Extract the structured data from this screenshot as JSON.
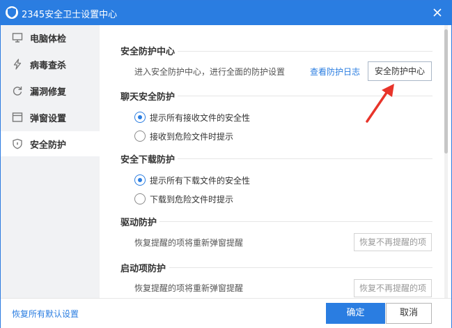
{
  "window": {
    "title": "2345安全卫士设置中心"
  },
  "sidebar": {
    "items": [
      {
        "label": "电脑体检",
        "icon": "monitor-icon"
      },
      {
        "label": "病毒查杀",
        "icon": "lightning-icon"
      },
      {
        "label": "漏洞修复",
        "icon": "refresh-icon"
      },
      {
        "label": "弹窗设置",
        "icon": "window-icon"
      },
      {
        "label": "安全防护",
        "icon": "shield-icon",
        "active": true
      }
    ]
  },
  "sections": {
    "protection_center": {
      "title": "安全防护中心",
      "desc": "进入安全防护中心，进行全面的防护设置",
      "log_link": "查看防护日志",
      "button": "安全防护中心"
    },
    "chat": {
      "title": "聊天安全防护",
      "options": [
        {
          "label": "提示所有接收文件的安全性",
          "checked": true
        },
        {
          "label": "接收到危险文件时提示",
          "checked": false
        }
      ]
    },
    "download": {
      "title": "安全下载防护",
      "options": [
        {
          "label": "提示所有下载文件的安全性",
          "checked": true
        },
        {
          "label": "下载到危险文件时提示",
          "checked": false
        }
      ]
    },
    "driver": {
      "title": "驱动防护",
      "desc": "恢复提醒的项将重新弹窗提醒",
      "button": "恢复不再提醒的项"
    },
    "startup": {
      "title": "启动项防护",
      "desc": "恢复提醒的项将重新弹窗提醒",
      "button": "恢复不再提醒的项"
    }
  },
  "footer": {
    "reset_link": "恢复所有默认设置",
    "ok": "确定",
    "cancel": "取消"
  },
  "colors": {
    "accent": "#2a7de1",
    "arrow": "#e8342a",
    "sidebar_bg": "#f1f2f4"
  }
}
